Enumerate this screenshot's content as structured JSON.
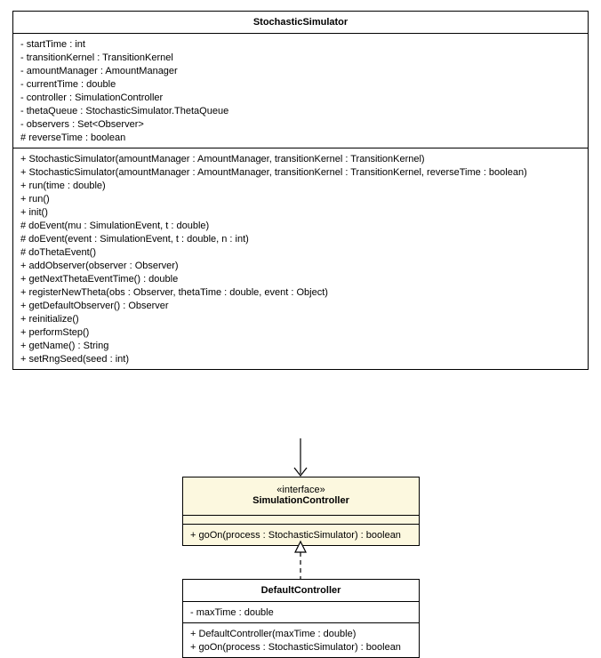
{
  "classes": {
    "stochasticSimulator": {
      "name": "StochasticSimulator",
      "attributes": [
        "- startTime : int",
        "- transitionKernel : TransitionKernel",
        "- amountManager : AmountManager",
        "- currentTime : double",
        "- controller : SimulationController",
        "- thetaQueue : StochasticSimulator.ThetaQueue",
        "- observers : Set<Observer>",
        "# reverseTime : boolean"
      ],
      "operations": [
        "+ StochasticSimulator(amountManager : AmountManager, transitionKernel : TransitionKernel)",
        "+ StochasticSimulator(amountManager : AmountManager, transitionKernel : TransitionKernel, reverseTime : boolean)",
        "+ run(time : double)",
        "+ run()",
        "+ init()",
        "# doEvent(mu : SimulationEvent, t : double)",
        "# doEvent(event : SimulationEvent, t : double, n : int)",
        "# doThetaEvent()",
        "+ addObserver(observer : Observer)",
        "+ getNextThetaEventTime() : double",
        "+ registerNewTheta(obs : Observer, thetaTime : double, event : Object)",
        "+ getDefaultObserver() : Observer",
        "+ reinitialize()",
        "+ performStep()",
        "+ getName() : String",
        "+ setRngSeed(seed : int)"
      ]
    },
    "simulationController": {
      "stereotype": "«interface»",
      "name": "SimulationController",
      "operations": [
        "+ goOn(process : StochasticSimulator) : boolean"
      ]
    },
    "defaultController": {
      "name": "DefaultController",
      "attributes": [
        "- maxTime : double"
      ],
      "operations": [
        "+ DefaultController(maxTime : double)",
        "+ goOn(process : StochasticSimulator) : boolean"
      ]
    }
  }
}
